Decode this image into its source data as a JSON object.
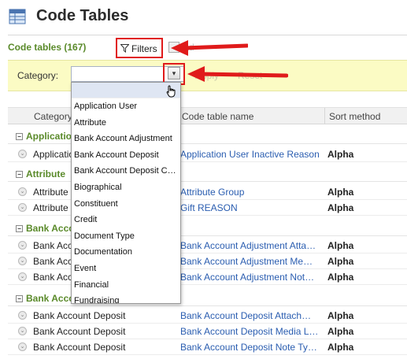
{
  "page": {
    "title": "Code Tables",
    "icon": "table-icon"
  },
  "section": {
    "title": "Code tables (167)",
    "filters_label": "Filters",
    "behind_text": "Ad"
  },
  "filter_bar": {
    "category_label": "Category:",
    "category_value": "",
    "apply_label": "Apply",
    "reset_label": "Reset"
  },
  "grid": {
    "columns": [
      "Category",
      "Code table name",
      "Sort method"
    ]
  },
  "groups": [
    {
      "label": "Application User"
    },
    {
      "label": "Attribute"
    },
    {
      "label": "Bank Account Adjustment"
    },
    {
      "label": "Bank Account Deposit"
    }
  ],
  "rows": [
    {
      "category": "Application User",
      "name": "Application User Inactive Reason",
      "sort": "Alpha"
    },
    {
      "category": "Attribute",
      "name": "Attribute Group",
      "sort": "Alpha"
    },
    {
      "category": "Attribute",
      "name": "Gift REASON",
      "sort": "Alpha"
    },
    {
      "category": "Bank Account Adjustment",
      "name": "Bank Account Adjustment Atta…",
      "sort": "Alpha"
    },
    {
      "category": "Bank Account Adjustment",
      "name": "Bank Account Adjustment Me…",
      "sort": "Alpha"
    },
    {
      "category": "Bank Account Adjustment",
      "name": "Bank Account Adjustment Not…",
      "sort": "Alpha"
    },
    {
      "category": "Bank Account Deposit",
      "name": "Bank Account Deposit Attach…",
      "sort": "Alpha"
    },
    {
      "category": "Bank Account Deposit",
      "name": "Bank Account Deposit Media L…",
      "sort": "Alpha"
    },
    {
      "category": "Bank Account Deposit",
      "name": "Bank Account Deposit Note Ty…",
      "sort": "Alpha"
    }
  ],
  "dropdown": {
    "options": [
      "Application User",
      "Attribute",
      "Bank Account Adjustment",
      "Bank Account Deposit",
      "Bank Account Deposit C…",
      "Biographical",
      "Constituent",
      "Credit",
      "Document Type",
      "Documentation",
      "Event",
      "Financial",
      "Fundraising"
    ]
  },
  "colors": {
    "accent_green": "#5a8a2a",
    "link_blue": "#2a5db0",
    "annotation_red": "#e01b1b",
    "filter_bar": "#fbfbc4"
  }
}
